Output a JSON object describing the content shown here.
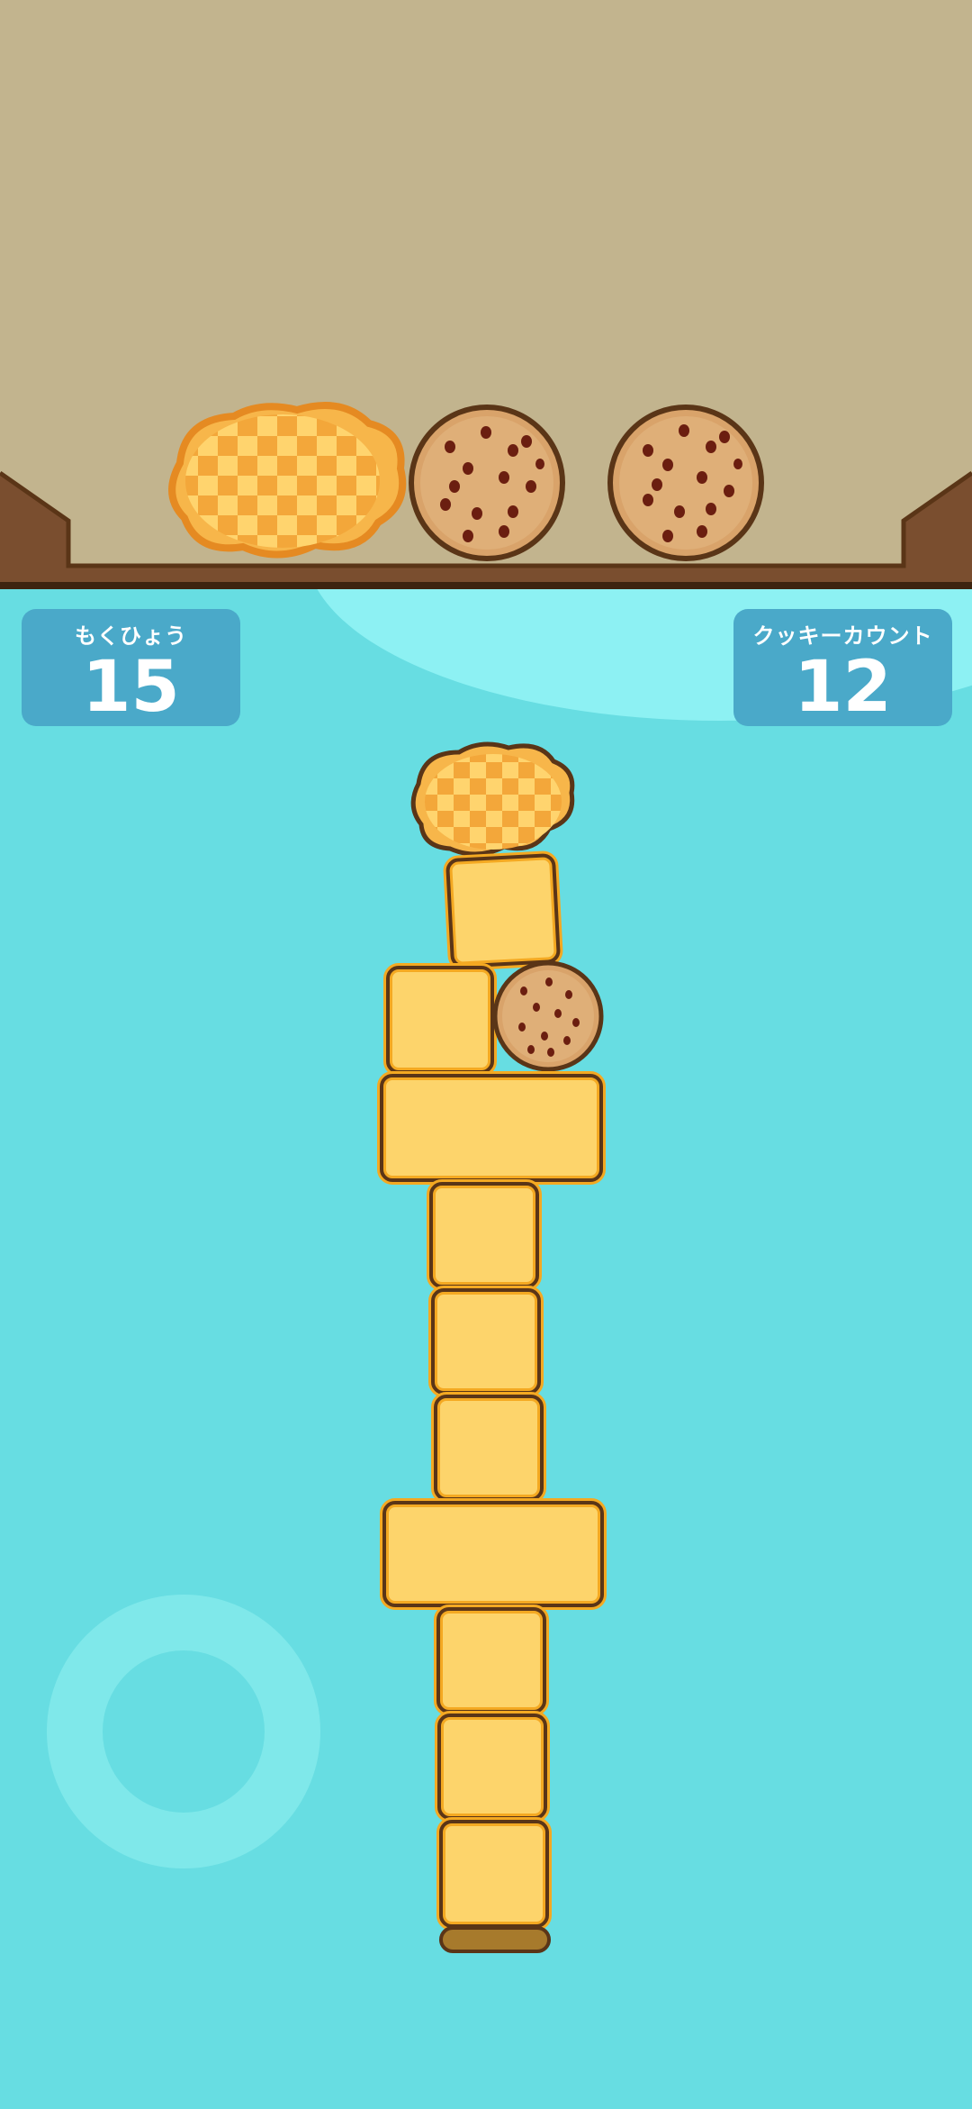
{
  "hud": {
    "goal": {
      "label": "もくひょう",
      "value": "15"
    },
    "cookie_count": {
      "label": "クッキーカウント",
      "value": "12"
    }
  },
  "queue": {
    "items": [
      "melon-pan",
      "cookie",
      "cookie"
    ]
  },
  "tower": {
    "pieces": [
      "melon-pan",
      "square-block",
      "square-block",
      "cookie",
      "wide-block",
      "square-block",
      "square-block",
      "square-block",
      "wide-block",
      "square-block",
      "square-block",
      "square-block"
    ]
  },
  "colors": {
    "tray": "#c2b48e",
    "wood": "#7a4e2f",
    "water": "#67dde2",
    "hud": "#4aa9c9",
    "block_fill": "#fdd46b",
    "block_border": "#f4a922",
    "outline": "#5a3517"
  }
}
